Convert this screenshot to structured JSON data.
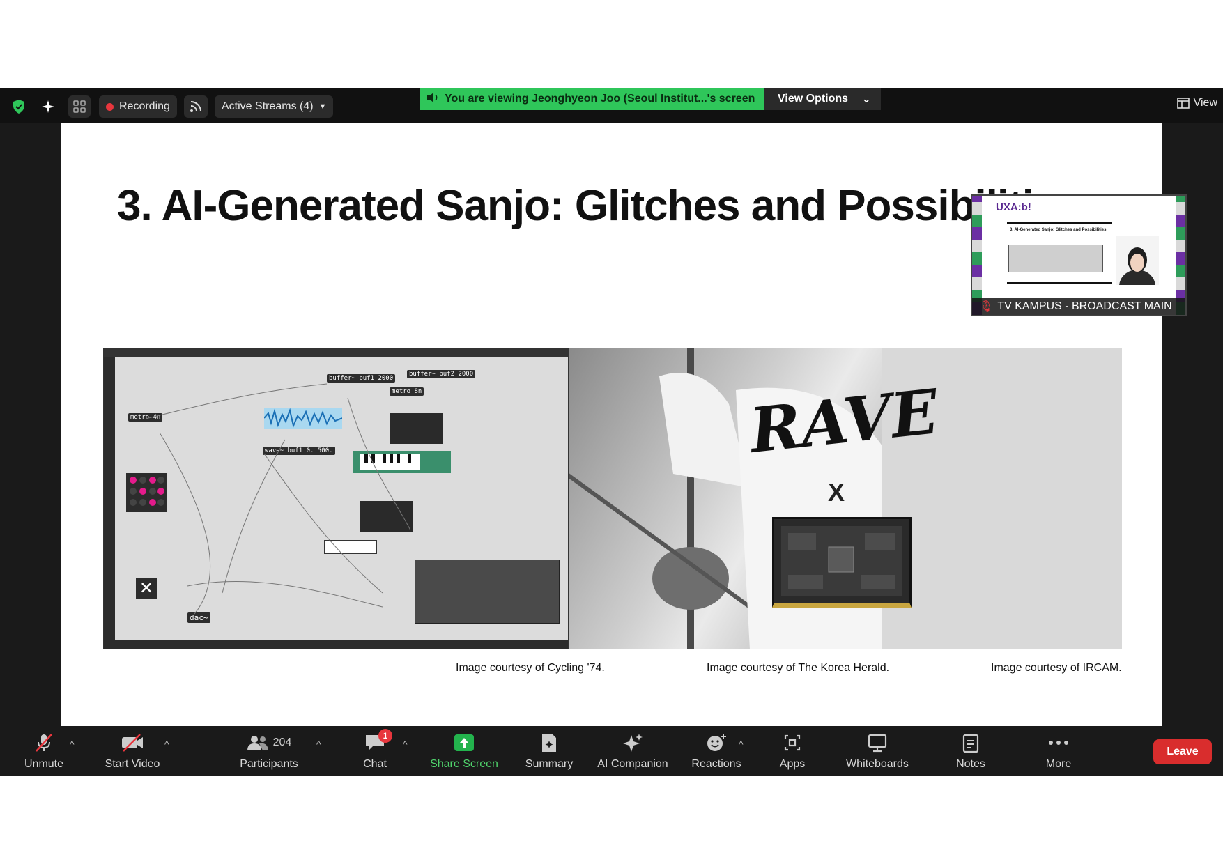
{
  "topbar": {
    "recording_label": "Recording",
    "streams_label": "Active Streams (4)",
    "banner_text": "You are viewing Jeonghyeon Joo (Seoul Institut...'s screen",
    "view_options_label": "View Options",
    "view_label": "View"
  },
  "slide": {
    "title": "3. AI-Generated Sanjo: Glitches and Possibiliti",
    "rave_text": "RAVE",
    "x_mark": "X",
    "captions": [
      "Image courtesy of Cycling '74.",
      "Image courtesy of The Korea Herald.",
      "Image courtesy of IRCAM."
    ]
  },
  "max_objects": [
    "metro 4n",
    "buffer~ buf1 2000",
    "buffer~ buf2 2000",
    "metro 8n",
    "wave~ buf1 0. 500.",
    "dac~"
  ],
  "thumbnail": {
    "label": "TV KAMPUS - BROADCAST MAIN",
    "logo_text": "UXA:b!",
    "slide_title": "3. AI-Generated Sanjo: Glitches and Possibilities"
  },
  "toolbar": {
    "unmute": "Unmute",
    "start_video": "Start Video",
    "participants": "Participants",
    "participants_count": "204",
    "chat": "Chat",
    "chat_badge": "1",
    "share_screen": "Share Screen",
    "summary": "Summary",
    "ai_companion": "AI Companion",
    "reactions": "Reactions",
    "apps": "Apps",
    "whiteboards": "Whiteboards",
    "notes": "Notes",
    "more": "More",
    "leave": "Leave"
  },
  "colors": {
    "banner_green": "#2fc65a",
    "leave_red": "#d92d2d",
    "share_green": "#23b34d",
    "recording_red": "#e8363d"
  }
}
